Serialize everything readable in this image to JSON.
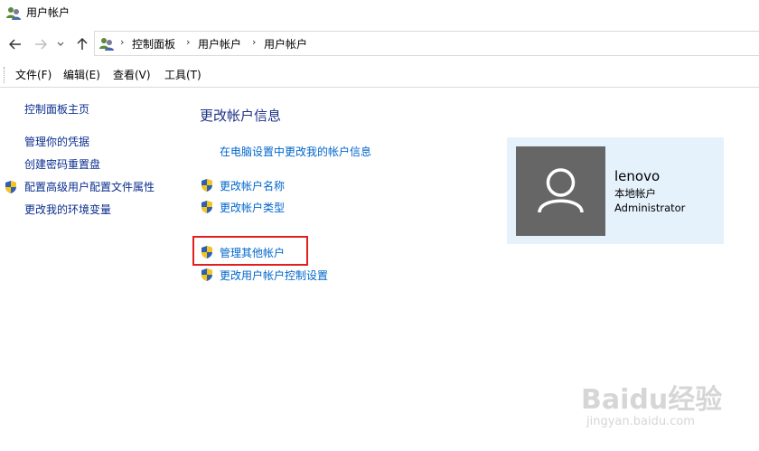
{
  "window": {
    "title": "用户帐户"
  },
  "navigation": {
    "breadcrumb": [
      "控制面板",
      "用户帐户",
      "用户帐户"
    ]
  },
  "menu": [
    "文件(F)",
    "编辑(E)",
    "查看(V)",
    "工具(T)"
  ],
  "sidebar": {
    "items": [
      {
        "label": "控制面板主页",
        "shield": false
      },
      {
        "label": "管理你的凭据",
        "shield": false
      },
      {
        "label": "创建密码重置盘",
        "shield": false
      },
      {
        "label": "配置高级用户配置文件属性",
        "shield": true
      },
      {
        "label": "更改我的环境变量",
        "shield": false
      }
    ]
  },
  "main": {
    "heading": "更改帐户信息",
    "links": [
      {
        "label": "在电脑设置中更改我的帐户信息",
        "shield": false
      },
      {
        "label": "更改帐户名称",
        "shield": true
      },
      {
        "label": "更改帐户类型",
        "shield": true
      },
      {
        "label": "管理其他帐户",
        "shield": true,
        "highlighted": true
      },
      {
        "label": "更改用户帐户控制设置",
        "shield": true
      }
    ]
  },
  "account": {
    "name": "lenovo",
    "type": "本地帐户",
    "role": "Administrator"
  },
  "watermark": {
    "brand": "Baidu经验",
    "url": "jingyan.baidu.com"
  },
  "colors": {
    "link": "#0066cc",
    "sidebar_link": "#0b2e8f",
    "heading": "#1e3287",
    "card_bg": "#e5f1fb",
    "avatar_bg": "#666666",
    "highlight": "#e02020"
  }
}
